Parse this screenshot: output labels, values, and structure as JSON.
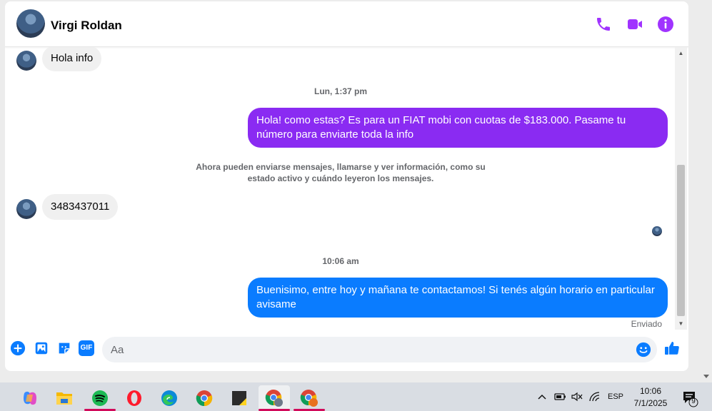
{
  "header": {
    "contact_name": "Virgi Roldan",
    "icons": [
      "phone-icon",
      "video-camera-icon",
      "info-icon"
    ],
    "accent_color": "#a033ff"
  },
  "messages": {
    "in_1": "Hola info",
    "timestamp_1": "Lun, 1:37 pm",
    "out_1": "Hola! como estas? Es para un FIAT mobi con cuotas de $183.000. Pasame tu número para enviarte toda la info",
    "notice": "Ahora pueden enviarse mensajes, llamarse y ver información, como su estado activo y cuándo leyeron los mensajes.",
    "in_2": "3483437011",
    "timestamp_2": "10:06 am",
    "out_2": "Buenisimo, entre hoy y mañana te contactamos! Si tenés algún horario en particular avisame",
    "status": "Enviado",
    "colors": {
      "out_1": "#8a2bf2",
      "out_2": "#0a7cff",
      "incoming": "#f0f0f0"
    }
  },
  "composer": {
    "placeholder": "Aa",
    "icons": [
      "plus-icon",
      "image-icon",
      "sticker-icon",
      "gif-icon",
      "emoji-icon",
      "thumbs-up-icon"
    ],
    "gif_label": "GIF",
    "accent_color": "#0a7cff"
  },
  "taskbar": {
    "apps": [
      "copilot-icon",
      "file-explorer-icon",
      "spotify-icon",
      "opera-icon",
      "edge-icon",
      "chrome-icon",
      "sticky-notes-icon",
      "chrome-profile-icon",
      "chrome-profile-2-icon"
    ],
    "language": "ESP",
    "time": "10:06",
    "date": "7/1/2025",
    "notification_count": "9"
  }
}
